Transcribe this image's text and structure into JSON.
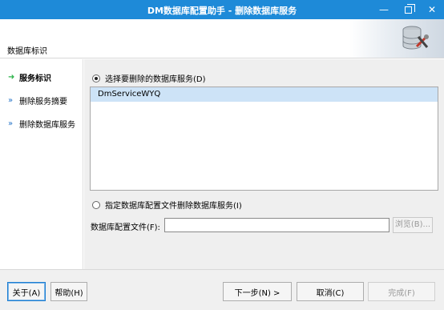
{
  "window": {
    "title": "DM数据库配置助手 - 删除数据库服务",
    "minimize_glyph": "—",
    "close_glyph": "✕"
  },
  "header": {
    "section_label": "数据库标识",
    "icon": "database-tools-icon"
  },
  "steps": [
    {
      "label": "服务标识",
      "icon": "green-arrow-icon",
      "active": true
    },
    {
      "label": "删除服务摘要",
      "icon": "blue-double-arrow-icon",
      "active": false
    },
    {
      "label": "删除数据库服务",
      "icon": "blue-double-arrow-icon",
      "active": false
    }
  ],
  "main": {
    "option_select_service": {
      "label": "选择要删除的数据库服务(D)",
      "checked": true
    },
    "services": [
      "DmServiceWYQ"
    ],
    "option_config_file": {
      "label": "指定数据库配置文件删除数据库服务(I)",
      "checked": false
    },
    "config_file_label": "数据库配置文件(F):",
    "config_file_value": "",
    "browse_label": "浏览(B)..."
  },
  "footer": {
    "about_label": "关于(A)",
    "help_label": "帮助(H)",
    "next_label": "下一步(N) >",
    "cancel_label": "取消(C)",
    "finish_label": "完成(F)"
  },
  "colors": {
    "titlebar": "#1e8ad8",
    "selected_row": "#cde3f7",
    "active_step_arrow": "#2db34a",
    "step_arrow": "#1e6fc6"
  }
}
